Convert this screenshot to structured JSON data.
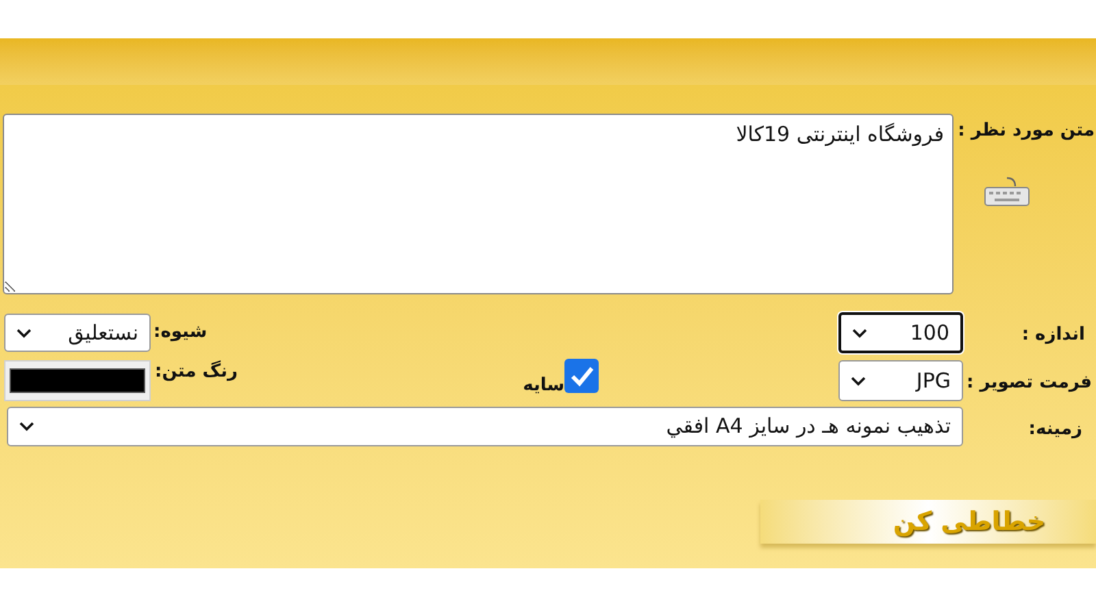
{
  "form": {
    "text": {
      "label": "متن مورد نظر :",
      "value": "فروشگاه اینترنتی 19کالا"
    },
    "size": {
      "label": "اندازه :",
      "value": "100",
      "focused": true
    },
    "style": {
      "label": "شیوه:",
      "value": "نستعلیق"
    },
    "format": {
      "label": "فرمت تصویر :",
      "value": "JPG"
    },
    "shadow": {
      "label": "سایه",
      "checked": true
    },
    "text_color": {
      "label": "رنگ متن:",
      "color": "#000000"
    },
    "background": {
      "label": "زمینه:",
      "value": "تذهیب نمونه هـ در سایز A4 افقي"
    }
  },
  "submit_button": {
    "label": "خطاطی کن"
  }
}
